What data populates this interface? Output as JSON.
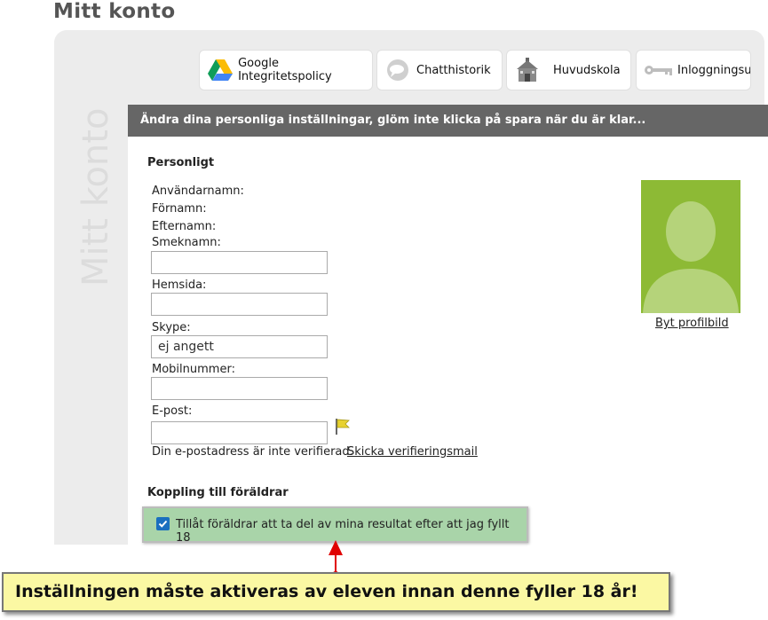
{
  "page": {
    "title": "Mitt konto",
    "side_title": "Mitt konto"
  },
  "tabs": [
    {
      "label": "Google Integritetspolicy",
      "icon": "google-drive-icon"
    },
    {
      "label": "Chatthistorik",
      "icon": "chat-bubble-icon"
    },
    {
      "label": "Huvudskola",
      "icon": "school-icon"
    },
    {
      "label": "Inloggningsupp",
      "icon": "key-icon"
    }
  ],
  "header": {
    "text": "Ändra dina personliga inställningar, glöm inte klicka på spara när du är klar..."
  },
  "personal": {
    "section_title": "Personligt",
    "username_label": "Användarnamn:",
    "firstname_label": "Förnamn:",
    "lastname_label": "Efternamn:",
    "nickname_label": "Smeknamn:",
    "nickname_value": "",
    "homepage_label": "Hemsida:",
    "homepage_value": "",
    "skype_label": "Skype:",
    "skype_value": "ej angett",
    "mobile_label": "Mobilnummer:",
    "mobile_value": "",
    "email_label": "E-post:",
    "email_value": "",
    "email_status": "Din e-postadress är inte verifierad.",
    "send_verification_link": "Skicka verifieringsmail",
    "change_picture_link": "Byt profilbild"
  },
  "parents": {
    "section_title": "Koppling till föräldrar",
    "consent_label": "Tillåt föräldrar att ta del av mina resultat efter att jag fyllt 18",
    "consent_checked": true
  },
  "annotation": {
    "text": "Inställningen måste aktiveras av eleven innan denne fyller 18 år!"
  },
  "colors": {
    "header_bar": "#666666",
    "avatar": "#8dba35",
    "consent_bg": "#a9d4a9",
    "callout_bg": "#fbf8a3",
    "arrow": "#e00000"
  }
}
